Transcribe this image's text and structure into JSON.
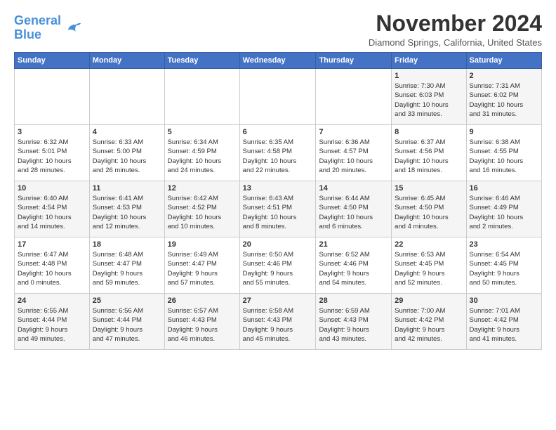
{
  "logo": {
    "line1": "General",
    "line2": "Blue"
  },
  "title": "November 2024",
  "location": "Diamond Springs, California, United States",
  "weekdays": [
    "Sunday",
    "Monday",
    "Tuesday",
    "Wednesday",
    "Thursday",
    "Friday",
    "Saturday"
  ],
  "weeks": [
    [
      {
        "day": "",
        "info": ""
      },
      {
        "day": "",
        "info": ""
      },
      {
        "day": "",
        "info": ""
      },
      {
        "day": "",
        "info": ""
      },
      {
        "day": "",
        "info": ""
      },
      {
        "day": "1",
        "info": "Sunrise: 7:30 AM\nSunset: 6:03 PM\nDaylight: 10 hours\nand 33 minutes."
      },
      {
        "day": "2",
        "info": "Sunrise: 7:31 AM\nSunset: 6:02 PM\nDaylight: 10 hours\nand 31 minutes."
      }
    ],
    [
      {
        "day": "3",
        "info": "Sunrise: 6:32 AM\nSunset: 5:01 PM\nDaylight: 10 hours\nand 28 minutes."
      },
      {
        "day": "4",
        "info": "Sunrise: 6:33 AM\nSunset: 5:00 PM\nDaylight: 10 hours\nand 26 minutes."
      },
      {
        "day": "5",
        "info": "Sunrise: 6:34 AM\nSunset: 4:59 PM\nDaylight: 10 hours\nand 24 minutes."
      },
      {
        "day": "6",
        "info": "Sunrise: 6:35 AM\nSunset: 4:58 PM\nDaylight: 10 hours\nand 22 minutes."
      },
      {
        "day": "7",
        "info": "Sunrise: 6:36 AM\nSunset: 4:57 PM\nDaylight: 10 hours\nand 20 minutes."
      },
      {
        "day": "8",
        "info": "Sunrise: 6:37 AM\nSunset: 4:56 PM\nDaylight: 10 hours\nand 18 minutes."
      },
      {
        "day": "9",
        "info": "Sunrise: 6:38 AM\nSunset: 4:55 PM\nDaylight: 10 hours\nand 16 minutes."
      }
    ],
    [
      {
        "day": "10",
        "info": "Sunrise: 6:40 AM\nSunset: 4:54 PM\nDaylight: 10 hours\nand 14 minutes."
      },
      {
        "day": "11",
        "info": "Sunrise: 6:41 AM\nSunset: 4:53 PM\nDaylight: 10 hours\nand 12 minutes."
      },
      {
        "day": "12",
        "info": "Sunrise: 6:42 AM\nSunset: 4:52 PM\nDaylight: 10 hours\nand 10 minutes."
      },
      {
        "day": "13",
        "info": "Sunrise: 6:43 AM\nSunset: 4:51 PM\nDaylight: 10 hours\nand 8 minutes."
      },
      {
        "day": "14",
        "info": "Sunrise: 6:44 AM\nSunset: 4:50 PM\nDaylight: 10 hours\nand 6 minutes."
      },
      {
        "day": "15",
        "info": "Sunrise: 6:45 AM\nSunset: 4:50 PM\nDaylight: 10 hours\nand 4 minutes."
      },
      {
        "day": "16",
        "info": "Sunrise: 6:46 AM\nSunset: 4:49 PM\nDaylight: 10 hours\nand 2 minutes."
      }
    ],
    [
      {
        "day": "17",
        "info": "Sunrise: 6:47 AM\nSunset: 4:48 PM\nDaylight: 10 hours\nand 0 minutes."
      },
      {
        "day": "18",
        "info": "Sunrise: 6:48 AM\nSunset: 4:47 PM\nDaylight: 9 hours\nand 59 minutes."
      },
      {
        "day": "19",
        "info": "Sunrise: 6:49 AM\nSunset: 4:47 PM\nDaylight: 9 hours\nand 57 minutes."
      },
      {
        "day": "20",
        "info": "Sunrise: 6:50 AM\nSunset: 4:46 PM\nDaylight: 9 hours\nand 55 minutes."
      },
      {
        "day": "21",
        "info": "Sunrise: 6:52 AM\nSunset: 4:46 PM\nDaylight: 9 hours\nand 54 minutes."
      },
      {
        "day": "22",
        "info": "Sunrise: 6:53 AM\nSunset: 4:45 PM\nDaylight: 9 hours\nand 52 minutes."
      },
      {
        "day": "23",
        "info": "Sunrise: 6:54 AM\nSunset: 4:45 PM\nDaylight: 9 hours\nand 50 minutes."
      }
    ],
    [
      {
        "day": "24",
        "info": "Sunrise: 6:55 AM\nSunset: 4:44 PM\nDaylight: 9 hours\nand 49 minutes."
      },
      {
        "day": "25",
        "info": "Sunrise: 6:56 AM\nSunset: 4:44 PM\nDaylight: 9 hours\nand 47 minutes."
      },
      {
        "day": "26",
        "info": "Sunrise: 6:57 AM\nSunset: 4:43 PM\nDaylight: 9 hours\nand 46 minutes."
      },
      {
        "day": "27",
        "info": "Sunrise: 6:58 AM\nSunset: 4:43 PM\nDaylight: 9 hours\nand 45 minutes."
      },
      {
        "day": "28",
        "info": "Sunrise: 6:59 AM\nSunset: 4:43 PM\nDaylight: 9 hours\nand 43 minutes."
      },
      {
        "day": "29",
        "info": "Sunrise: 7:00 AM\nSunset: 4:42 PM\nDaylight: 9 hours\nand 42 minutes."
      },
      {
        "day": "30",
        "info": "Sunrise: 7:01 AM\nSunset: 4:42 PM\nDaylight: 9 hours\nand 41 minutes."
      }
    ]
  ]
}
